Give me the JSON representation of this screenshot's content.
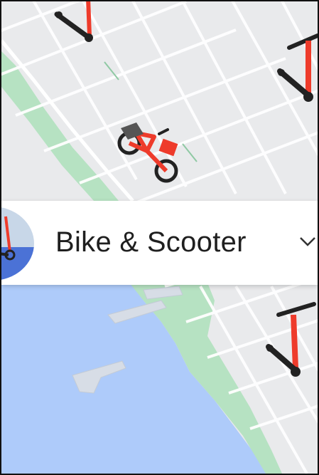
{
  "mode_selector": {
    "label": "Bike & Scooter",
    "icon": "scooter-icon",
    "dropdown_icon": "chevron-down-icon"
  },
  "map": {
    "vehicles": [
      "scooter-icon",
      "scooter-icon",
      "bike-icon",
      "scooter-icon"
    ],
    "colors": {
      "land": "#e9eaec",
      "park": "#b6e2c2",
      "water": "#aecbfa",
      "road": "#ffffff",
      "vehicle_red": "#ee3b2b"
    }
  }
}
